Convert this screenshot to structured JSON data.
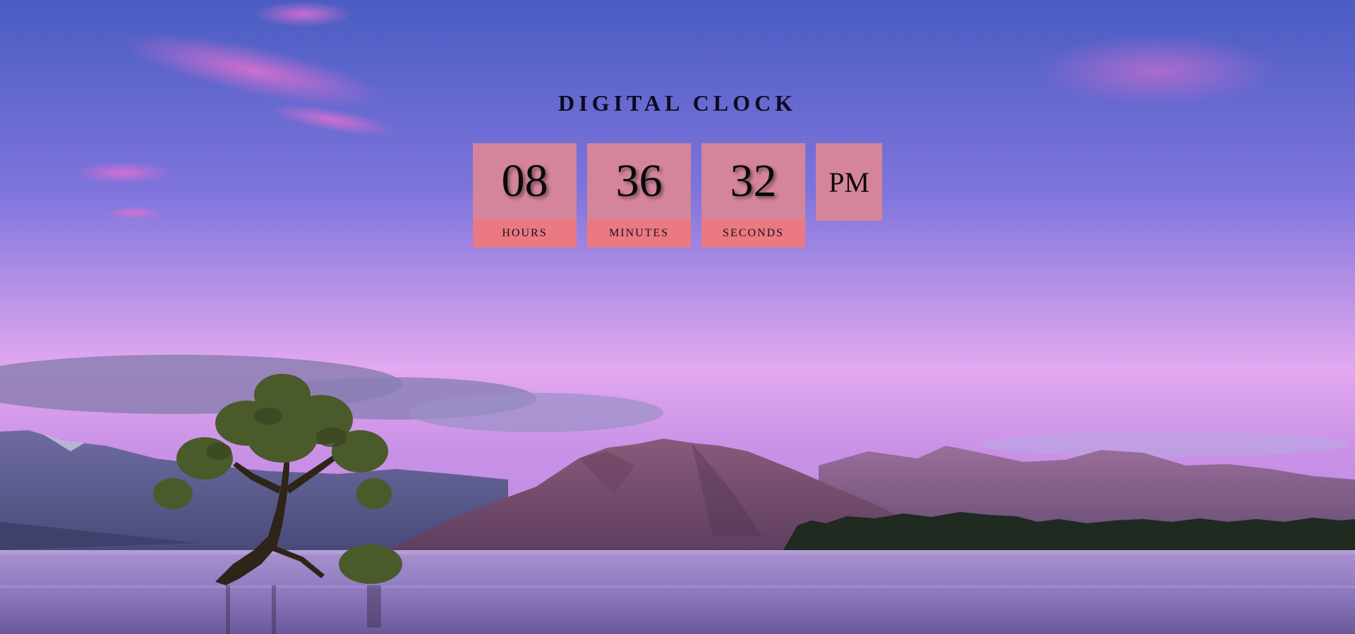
{
  "title": "DIGITAL CLOCK",
  "clock": {
    "hours": "08",
    "minutes": "36",
    "seconds": "32",
    "ampm": "PM",
    "labels": {
      "hours": "HOURS",
      "minutes": "MINUTES",
      "seconds": "SECONDS"
    }
  },
  "colors": {
    "tile": "#d4849b",
    "label_strip": "#ea7982",
    "sky_top": "#4a5fc4",
    "sky_bottom": "#e0a6ee",
    "water": "#9a82c4"
  }
}
